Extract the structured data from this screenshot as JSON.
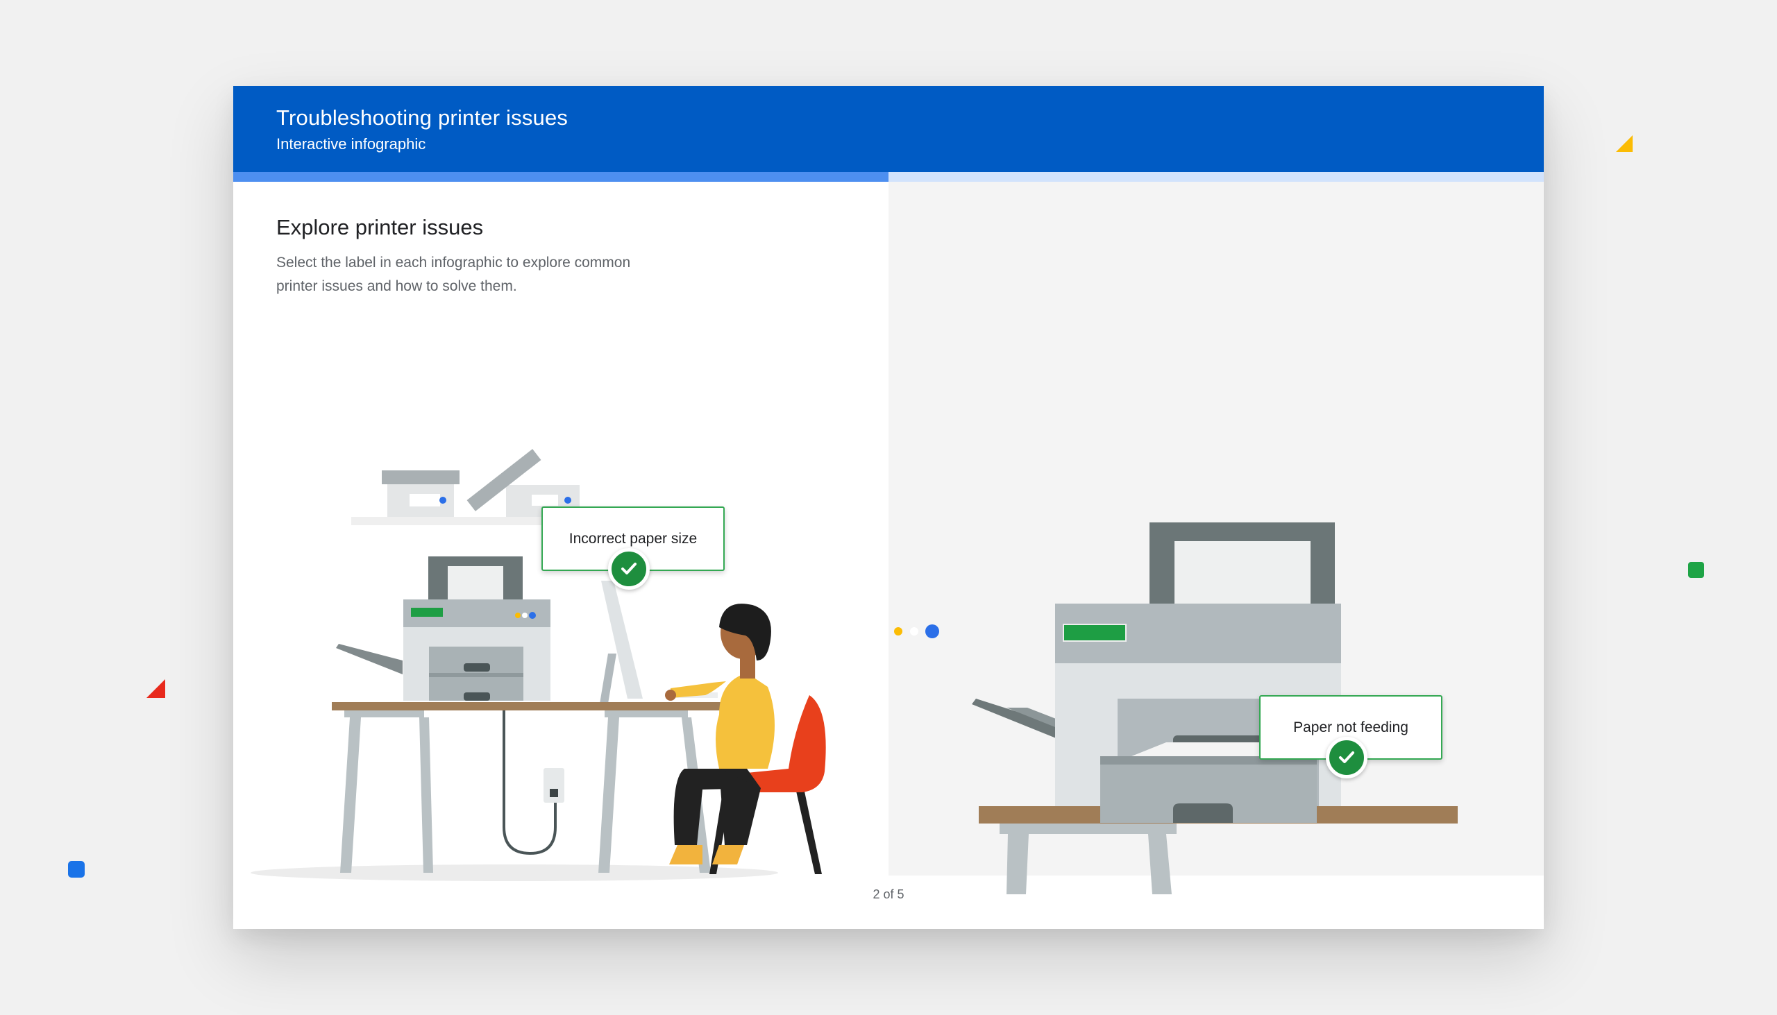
{
  "header": {
    "title": "Troubleshooting printer issues",
    "subtitle": "Interactive infographic"
  },
  "progress": {
    "fraction": 0.5
  },
  "left": {
    "title": "Explore printer issues",
    "description": "Select the label in each infographic to explore common printer issues and how to solve them.",
    "hotspot_label": "Incorrect paper size"
  },
  "right": {
    "hotspot_label": "Paper not feeding"
  },
  "pager": {
    "text": "2 of 5"
  },
  "icons": {
    "hotspot": "check-circle-icon"
  },
  "colors": {
    "header": "#005bc4",
    "progress_fill": "#4d8ff0",
    "progress_track": "#d2e3fc",
    "hotspot_border": "#34a853",
    "check": "#1e8e3e"
  }
}
